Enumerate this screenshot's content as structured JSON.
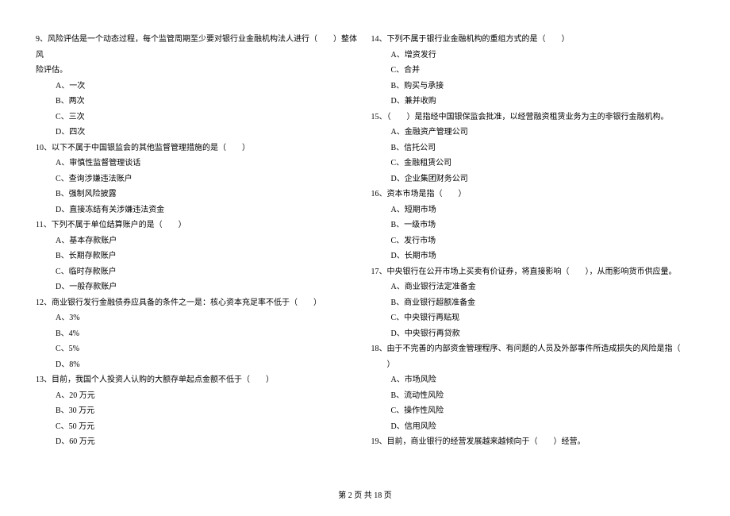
{
  "left_col": {
    "q9": {
      "text_pre": "9、风险评估是一个动态过程，每个监管周期至少要对银行业金融机构法人进行（",
      "text_post": "）整体风",
      "text_line2": "险评估。",
      "A": "A、一次",
      "B": "B、两次",
      "C": "C、三次",
      "D": "D、四次"
    },
    "q10": {
      "text_pre": "10、以下不属于中国银监会的其他监督管理措施的是（",
      "text_post": "）",
      "A": "A、审慎性监督管理谈话",
      "B": "B、强制风险披露",
      "C": "C、查询涉嫌违法账户",
      "D": "D、直接冻结有关涉嫌违法资金"
    },
    "q11": {
      "text_pre": "11、下列不属于单位结算账户的是（",
      "text_post": "）",
      "A": "A、基本存款账户",
      "B": "B、长期存款账户",
      "C": "C、临时存款账户",
      "D": "D、一般存款账户"
    },
    "q12": {
      "text_pre": "12、商业银行发行金融债券应具备的条件之一是：核心资本充足率不低于（",
      "text_post": "）",
      "A": "A、3%",
      "B": "B、4%",
      "C": "C、5%",
      "D": "D、8%"
    },
    "q13": {
      "text_pre": "13、目前，我国个人投资人认购的大额存单起点金额不低于（",
      "text_post": "）",
      "A": "A、20 万元",
      "B": "B、30 万元",
      "C": "C、50 万元",
      "D": "D、60 万元"
    }
  },
  "right_col": {
    "q14": {
      "text_pre": "14、下列不属于银行业金融机构的重组方式的是（",
      "text_post": "）",
      "A": "A、增资发行",
      "B": "B、购买与承接",
      "C": "C、合并",
      "D": "D、兼并收购"
    },
    "q15": {
      "text_pre": "15、（",
      "text_post": "）是指经中国银保监会批准，以经营融资租赁业务为主的非银行金融机构。",
      "A": "A、金融资产管理公司",
      "B": "B、信托公司",
      "C": "C、金融租赁公司",
      "D": "D、企业集团财务公司"
    },
    "q16": {
      "text_pre": "16、资本市场是指（",
      "text_post": "）",
      "A": "A、短期市场",
      "B": "B、一级市场",
      "C": "C、发行市场",
      "D": "D、长期市场"
    },
    "q17": {
      "text_pre": "17、中央银行在公开市场上买卖有价证券，将直接影响（",
      "text_post": "），从而影响货币供应量。",
      "A": "A、商业银行法定准备金",
      "B": "B、商业银行超额准备金",
      "C": "C、中央银行再贴现",
      "D": "D、中央银行再贷款"
    },
    "q18": {
      "text_pre": "18、由于不完善的内部资金管理程序、有问题的人员及外部事件所造成损失的风险是指（",
      "text_post": "）",
      "A": "A、市场风险",
      "B": "B、流动性风险",
      "C": "C、操作性风险",
      "D": "D、信用风险"
    },
    "q19": {
      "text_pre": "19、目前，商业银行的经营发展越来越倾向于（",
      "text_post": "）经营。"
    }
  },
  "footer": "第 2 页 共 18 页"
}
